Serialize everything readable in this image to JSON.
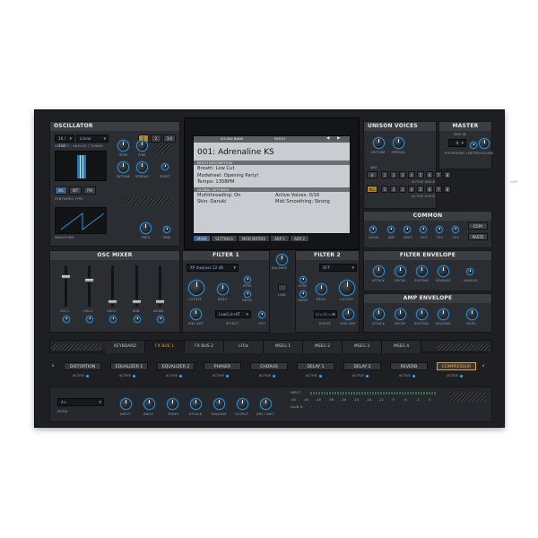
{
  "oscillator": {
    "title": "OSCILLATOR",
    "wave_select": "Linear",
    "wave_index": "16 / 100",
    "subtitle": "DENSITY / ANALOG / TUNING",
    "osc_buttons": [
      "1",
      "2",
      "3/4"
    ],
    "knobs": [
      {
        "label": "SEMI"
      },
      {
        "label": "FINE"
      },
      {
        "label": "DETUNE"
      },
      {
        "label": "SPREAD"
      },
      {
        "label": "PHASE"
      },
      {
        "label": "RESET"
      }
    ],
    "synth_type_buttons": [
      "WL",
      "WT",
      "FM"
    ],
    "synth_type_label": "SYNTHESIS TYPE",
    "waveform_label": "WAVEFORM",
    "knob_freq": "FREQ",
    "knob_sine": "SINE"
  },
  "display": {
    "tabs_top": [
      "SOUND BANK",
      "PATCH"
    ],
    "patch_name": "001: Adrenaline KS",
    "section1": "PATCH DESCRIPTION",
    "desc_lines": [
      "Breath: Low Cut",
      "Modwheel: Opening Party!",
      "Tempo: 135BPM"
    ],
    "section2": "GLOBAL SETTINGS",
    "global_left": [
      "Multithreading: On",
      "Skin: Danuki"
    ],
    "global_right": [
      "Active Voices: 0/16",
      "Midi Smoothing: Strong"
    ],
    "bottom_tabs": [
      "MAIN",
      "SETTINGS",
      "MOD MATRIX",
      "ARP 1",
      "ARP 2"
    ]
  },
  "unison": {
    "title": "UNISON VOICES",
    "knobs": [
      "DETUNE",
      "SPREAD"
    ],
    "row1_label": "ACTIVE VOICE",
    "row2_label": "ACTIVE VOICE",
    "amp_label": "AMP",
    "all_button": "ALL",
    "amt_label": "AMT",
    "row1": [
      "4",
      "1",
      "2",
      "3",
      "4",
      "5",
      "6",
      "7",
      "8"
    ],
    "row2": [
      "1",
      "2",
      "3",
      "4",
      "5",
      "6",
      "7",
      "8"
    ]
  },
  "master": {
    "title": "MASTER",
    "polyphony_value": "4",
    "midi_in": "MIDI IN",
    "labels": [
      "POLYPHONY",
      "LIMITER",
      "VOLUME"
    ]
  },
  "common": {
    "title": "COMMON",
    "labels": [
      "GLIDE",
      "ARP",
      "ARP2",
      "OCT",
      "FX1",
      "FX2"
    ],
    "buttons": [
      "COPY",
      "PASTE"
    ]
  },
  "osc_mixer": {
    "title": "OSC MIXER",
    "channels": [
      "OSC1",
      "OSC2",
      "OSC3",
      "SUB",
      "NOISE"
    ]
  },
  "filter1": {
    "title": "FILTER 1",
    "type": "XP lowpass 12 dB",
    "knobs": [
      "CUTOFF",
      "RESO",
      "DRIVE",
      "ENV AMT",
      "KTRK",
      "EFFECT"
    ],
    "effect_select": "LowCut+KT"
  },
  "filter_center": {
    "balance": "BALANCE",
    "link": "LINK",
    "out": "OUT",
    "sat": "SAT"
  },
  "filter2": {
    "title": "FILTER 2",
    "type": "OFF",
    "knobs": [
      "KTRK",
      "DRIVE",
      "RESO",
      "CUTOFF",
      "ENV AMT",
      "ROUTE"
    ],
    "route_value": "F1 > F2 > F3"
  },
  "filter_envelope": {
    "title": "FILTER ENVELOPE",
    "knobs": [
      "ATTACK",
      "DECAY",
      "SUSTAIN",
      "RELEASE",
      "ANALOG"
    ]
  },
  "amp_envelope": {
    "title": "AMP ENVELOPE",
    "knobs": [
      "ATTACK",
      "DECAY",
      "SUSTAIN",
      "RELEASE",
      "LEVEL"
    ]
  },
  "tabs": [
    "KEYBOARD",
    "FX BUS 1",
    "FX BUS 2",
    "LFOs",
    "MSEG 1",
    "MSEG 2",
    "MSEG 3",
    "MSEG 4"
  ],
  "fx_chain": {
    "items": [
      "DISTORTION",
      "EQUALIZER 1",
      "EQUALIZER 2",
      "PHASER",
      "CHORUS",
      "DELAY 1",
      "DELAY 2",
      "REVERB",
      "COMPRESSOR"
    ],
    "active_label": "ACTIVE"
  },
  "compressor": {
    "mode_value": "A+",
    "mode_label": "MODE",
    "knobs": [
      "INPUT",
      "RATIO",
      "THRES",
      "ATTACK",
      "RELEASE",
      "OUTPUT",
      "DRY / WET"
    ],
    "meter_labels": [
      "INPUT",
      "GAIN R."
    ],
    "scale": [
      "-60",
      "-48",
      "-40",
      "-36",
      "-30",
      "-24",
      "-18",
      "-12",
      "-9",
      "-6",
      "-3",
      "0"
    ]
  },
  "colors": {
    "accent": "#2e8fd8",
    "active_tab": "#e2a33b",
    "panel": "#2a2d31"
  }
}
